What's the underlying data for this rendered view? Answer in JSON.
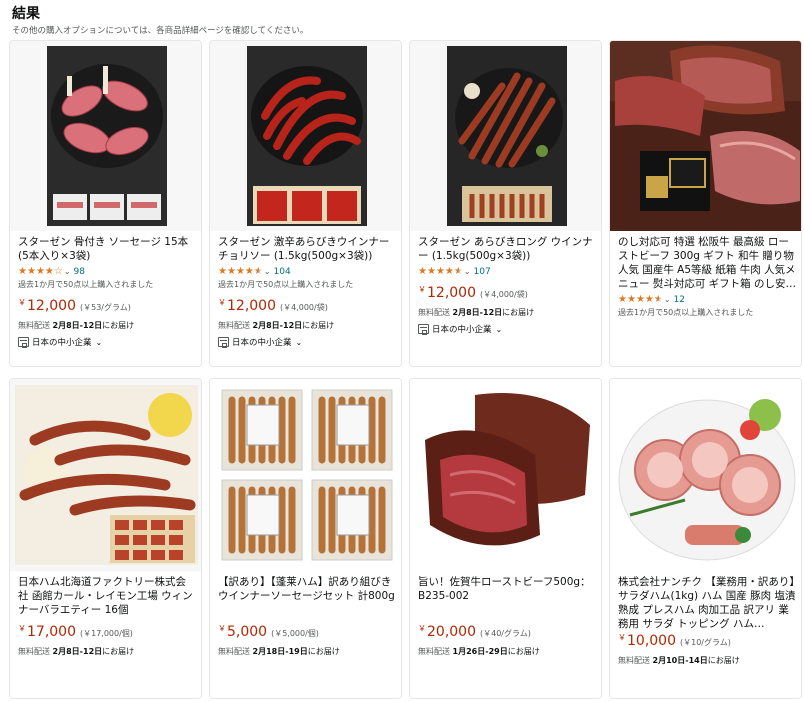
{
  "header": {
    "title": "結果",
    "subtitle": "その他の購入オプションについては、各商品詳細ページを確認してください。"
  },
  "icons": {
    "star": "star-icon",
    "chevron": "chevron-down-icon",
    "badge": "storefront-icon"
  },
  "colors": {
    "price": "#b12704",
    "star": "#de7921",
    "link": "#007185"
  },
  "products": [
    {
      "title": "スターゼン 骨付き ソーセージ 15本 (5本入り×3袋)",
      "rating": 4.0,
      "rating_count": "98",
      "bought": "過去1か月で50点以上購入されました",
      "price": "12,000",
      "unit_price": "(￥53/グラム)",
      "delivery_label": "無料配送",
      "delivery_date": "2月8日-12日",
      "delivery_suffix": "にお届け",
      "badge": "日本の中小企業"
    },
    {
      "title": "スターゼン 激辛あらびきウインナーチョリソー (1.5kg(500g×3袋))",
      "rating": 4.5,
      "rating_count": "104",
      "bought": "過去1か月で50点以上購入されました",
      "price": "12,000",
      "unit_price": "(￥4,000/袋)",
      "delivery_label": "無料配送",
      "delivery_date": "2月8日-12日",
      "delivery_suffix": "にお届け",
      "badge": "日本の中小企業"
    },
    {
      "title": "スターゼン あらびきロング ウインナー (1.5kg(500g×3袋))",
      "rating": 4.5,
      "rating_count": "107",
      "bought": "",
      "price": "12,000",
      "unit_price": "(￥4,000/袋)",
      "delivery_label": "無料配送",
      "delivery_date": "2月8日-12日",
      "delivery_suffix": "にお届け",
      "badge": "日本の中小企業"
    },
    {
      "title": "のし対応可 特選 松阪牛 最高級 ローストビーフ 300g ギフト 和牛 贈り物 人気 国産牛 A5等級 紙箱 牛肉 人気メニュー 熨斗対応可 ギフト箱 のし安…",
      "rating": 4.5,
      "rating_count": "12",
      "bought": "過去1か月で50点以上購入されました",
      "price": "",
      "unit_price": "",
      "delivery_label": "",
      "delivery_date": "",
      "delivery_suffix": "",
      "badge": ""
    },
    {
      "title": "日本ハム北海道ファクトリー株式会社 函館カール・レイモン工場 ウィンナーバラエティー 16個",
      "rating": null,
      "rating_count": "",
      "bought": "",
      "price": "17,000",
      "unit_price": "(￥17,000/個)",
      "delivery_label": "無料配送",
      "delivery_date": "2月8日-12日",
      "delivery_suffix": "にお届け",
      "badge": ""
    },
    {
      "title": "【訳あり】【蓬莱ハム】訳あり組びきウインナーソーセージセット 計800g",
      "rating": null,
      "rating_count": "",
      "bought": "",
      "price": "5,000",
      "unit_price": "(￥5,000/個)",
      "delivery_label": "無料配送",
      "delivery_date": "2月18日-19日",
      "delivery_suffix": "にお届け",
      "badge": ""
    },
    {
      "title": "旨い！佐賀牛ローストビーフ500g：B235-002",
      "rating": null,
      "rating_count": "",
      "bought": "",
      "price": "20,000",
      "unit_price": "(￥40/グラム)",
      "delivery_label": "無料配送",
      "delivery_date": "1月26日-29日",
      "delivery_suffix": "にお届け",
      "badge": ""
    },
    {
      "title": "株式会社ナンチク 【業務用・訳あり】サラダハム(1kg) ハム 国産 豚肉 塩漬 熟成 プレスハム 肉加工品 訳アリ 業務用 サラダ トッピング ハム…",
      "rating": null,
      "rating_count": "",
      "bought": "",
      "price": "10,000",
      "unit_price": "(￥10/グラム)",
      "delivery_label": "無料配送",
      "delivery_date": "2月10日-14日",
      "delivery_suffix": "にお届け",
      "badge": ""
    }
  ]
}
